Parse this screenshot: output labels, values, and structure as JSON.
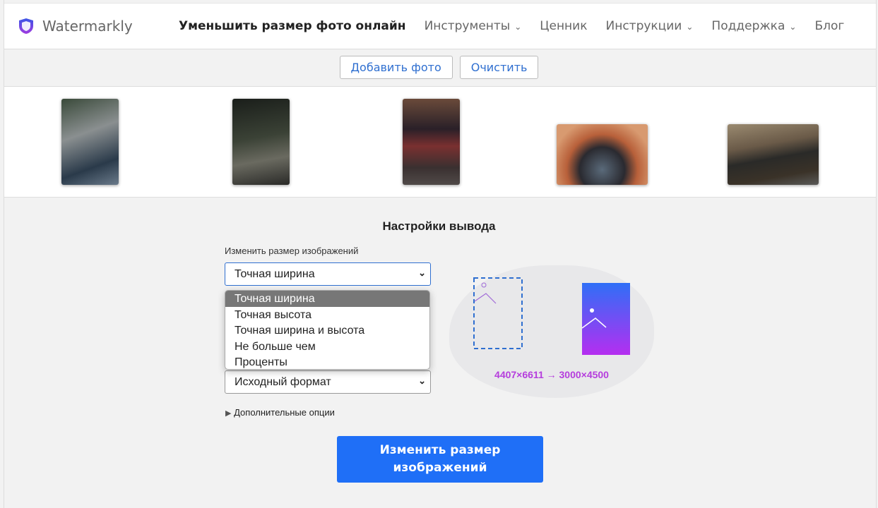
{
  "header": {
    "logo": "Watermarkly",
    "nav": [
      {
        "label": "Уменьшить размер фото онлайн",
        "dropdown": false
      },
      {
        "label": "Инструменты",
        "dropdown": true
      },
      {
        "label": "Ценник",
        "dropdown": false
      },
      {
        "label": "Инструкции",
        "dropdown": true
      },
      {
        "label": "Поддержка",
        "dropdown": true
      },
      {
        "label": "Блог",
        "dropdown": false
      }
    ]
  },
  "toolbar": {
    "add_photo": "Добавить фото",
    "clear": "Очистить"
  },
  "settings": {
    "title": "Настройки вывода",
    "resize_label": "Изменить размер изображений",
    "resize_value": "Точная ширина",
    "resize_options": [
      "Точная ширина",
      "Точная высота",
      "Точная ширина и высота",
      "Не больше чем",
      "Проценты"
    ],
    "format_value": "Исходный формат",
    "more_options": "Дополнительные опции",
    "dims": "4407×6611 → 3000×4500",
    "submit": "Изменить размер изображений"
  },
  "colors": {
    "accent": "#1f6ff7",
    "dims": "#b53ddd"
  }
}
